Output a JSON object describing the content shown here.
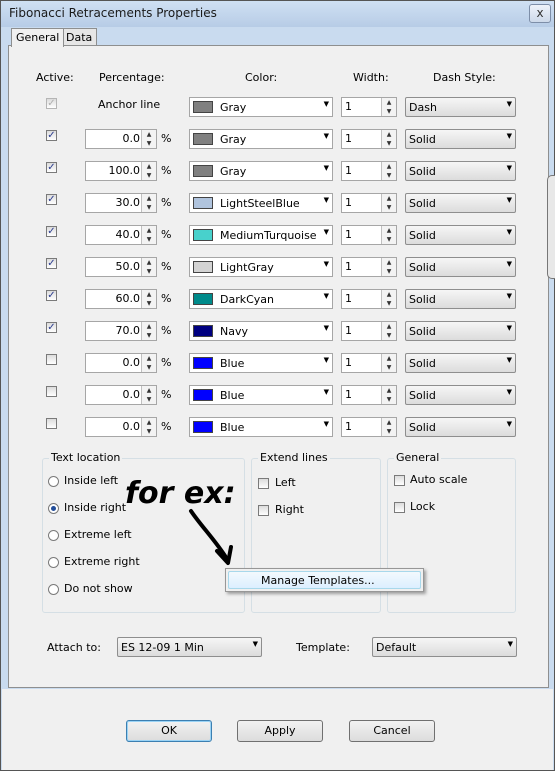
{
  "window": {
    "title": "Fibonacci Retracements Properties",
    "close_glyph": "x"
  },
  "tabs": [
    {
      "label": "General"
    },
    {
      "label": "Data"
    }
  ],
  "headers": {
    "active": "Active:",
    "percentage": "Percentage:",
    "color": "Color:",
    "width": "Width:",
    "dash_style": "Dash Style:"
  },
  "anchor_row": {
    "label": "Anchor line",
    "color": "Gray",
    "swatch": "#808080",
    "width": "1",
    "dash": "Dash",
    "checked": true,
    "disabled": true
  },
  "levels": [
    {
      "checked": true,
      "value": "0.0",
      "color": "Gray",
      "swatch": "#808080",
      "width": "1",
      "dash": "Solid"
    },
    {
      "checked": true,
      "value": "100.0",
      "color": "Gray",
      "swatch": "#808080",
      "width": "1",
      "dash": "Solid"
    },
    {
      "checked": true,
      "value": "30.0",
      "color": "LightSteelBlue",
      "swatch": "#b0c4de",
      "width": "1",
      "dash": "Solid"
    },
    {
      "checked": true,
      "value": "40.0",
      "color": "MediumTurquoise",
      "swatch": "#48d1cc",
      "width": "1",
      "dash": "Solid"
    },
    {
      "checked": true,
      "value": "50.0",
      "color": "LightGray",
      "swatch": "#d3d3d3",
      "width": "1",
      "dash": "Solid"
    },
    {
      "checked": true,
      "value": "60.0",
      "color": "DarkCyan",
      "swatch": "#008b8b",
      "width": "1",
      "dash": "Solid"
    },
    {
      "checked": true,
      "value": "70.0",
      "color": "Navy",
      "swatch": "#000080",
      "width": "1",
      "dash": "Solid"
    },
    {
      "checked": false,
      "value": "0.0",
      "color": "Blue",
      "swatch": "#0000ff",
      "width": "1",
      "dash": "Solid"
    },
    {
      "checked": false,
      "value": "0.0",
      "color": "Blue",
      "swatch": "#0000ff",
      "width": "1",
      "dash": "Solid"
    },
    {
      "checked": false,
      "value": "0.0",
      "color": "Blue",
      "swatch": "#0000ff",
      "width": "1",
      "dash": "Solid"
    }
  ],
  "percent_sign": "%",
  "text_location": {
    "label": "Text location",
    "options": [
      {
        "label": "Inside left",
        "selected": false
      },
      {
        "label": "Inside right",
        "selected": true
      },
      {
        "label": "Extreme left",
        "selected": false
      },
      {
        "label": "Extreme right",
        "selected": false
      },
      {
        "label": "Do not show",
        "selected": false
      }
    ]
  },
  "extend_lines": {
    "label": "Extend lines",
    "left": "Left",
    "right": "Right"
  },
  "general_group": {
    "label": "General",
    "auto_scale": "Auto scale",
    "lock": "Lock"
  },
  "context_menu": {
    "item": "Manage Templates..."
  },
  "annotation": {
    "text": "for ex:",
    "color": "#000000"
  },
  "attach": {
    "label": "Attach to:",
    "value": "ES 12-09 1 Min"
  },
  "template": {
    "label": "Template:",
    "value": "Default"
  },
  "buttons": {
    "ok": "OK",
    "apply": "Apply",
    "cancel": "Cancel"
  },
  "colors": {
    "accent_check": "#2b3c8f",
    "dialog_bg": "#f0f0f0",
    "frame": "#c9dbef"
  }
}
